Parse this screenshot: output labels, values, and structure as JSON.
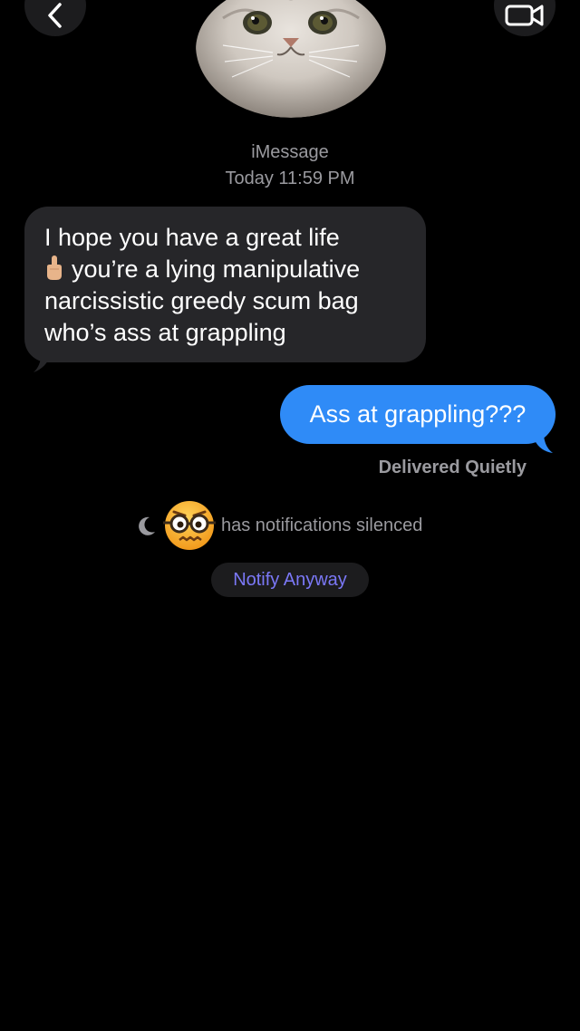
{
  "header": {
    "service": "iMessage",
    "timestamp": "Today 11:59 PM",
    "avatar_icon": "cat-face-avatar",
    "back_icon": "chevron-left-icon",
    "video_icon": "video-camera-icon"
  },
  "messages": [
    {
      "direction": "incoming",
      "emoji_icon": "middle-finger-emoji",
      "lines": [
        "I hope you have a great life",
        "you’re a lying manipulative",
        "narcissistic greedy scum bag",
        "who’s ass at grappling"
      ]
    },
    {
      "direction": "outgoing",
      "text": "Ass at grappling???"
    }
  ],
  "status": {
    "delivered": "Delivered Quietly",
    "silenced_text": "has notifications silenced",
    "moon_icon": "moon-icon",
    "contact_emoji": "nerd-face-emoji",
    "notify_button": "Notify Anyway"
  },
  "colors": {
    "background": "#000000",
    "incoming_bubble": "#262629",
    "outgoing_bubble": "#2f8bf7",
    "secondary_text": "#9a9a9f",
    "notify_text": "#7b78f7"
  }
}
